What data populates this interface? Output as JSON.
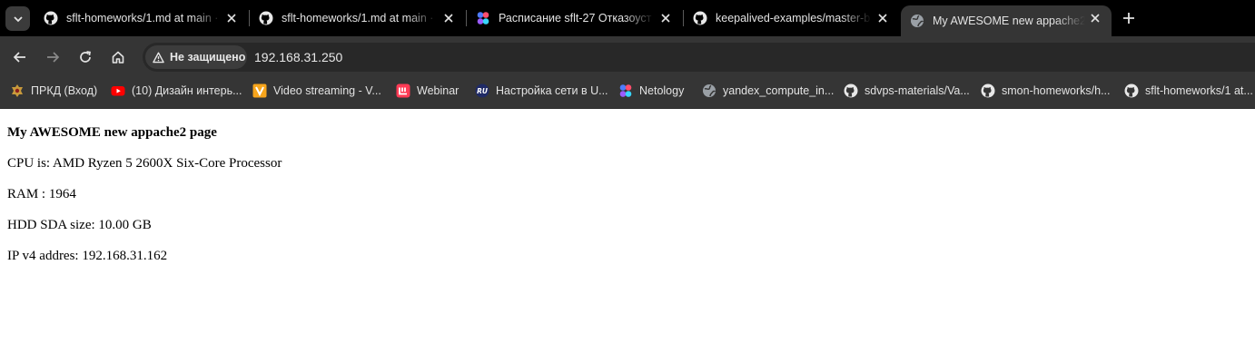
{
  "tabs": [
    {
      "title": "sflt-homeworks/1.md at main · ",
      "icon": "github-icon"
    },
    {
      "title": "sflt-homeworks/1.md at main · ",
      "icon": "github-icon"
    },
    {
      "title": "Расписание sflt-27 Отказоуст",
      "icon": "netology-icon"
    },
    {
      "title": "keepalived-examples/master-b",
      "icon": "github-icon"
    },
    {
      "title": "My AWESOME new appache2 p",
      "icon": "globe-icon"
    }
  ],
  "toolbar": {
    "security_label": "Не защищено",
    "url": "192.168.31.250"
  },
  "bookmarks": [
    {
      "label": "ПРКД (Вход)",
      "icon": "crest-icon"
    },
    {
      "label": "(10) Дизайн интерь...",
      "icon": "youtube-icon"
    },
    {
      "label": "Video streaming - V...",
      "icon": "vlc-icon"
    },
    {
      "label": "Webinar",
      "icon": "webinar-icon"
    },
    {
      "label": "Настройка сети в U...",
      "icon": "ru-icon"
    },
    {
      "label": "Netology",
      "icon": "netology-icon"
    },
    {
      "label": "yandex_compute_in...",
      "icon": "globe-icon"
    },
    {
      "label": "sdvps-materials/Va...",
      "icon": "github-icon"
    },
    {
      "label": "smon-homeworks/h...",
      "icon": "github-icon"
    },
    {
      "label": "sflt-homeworks/1 at...",
      "icon": "github-icon"
    }
  ],
  "page": {
    "heading": "My AWESOME new appache2 page",
    "cpu": "CPU is: AMD Ryzen 5 2600X Six-Core Processor",
    "ram": "RAM : 1964",
    "hdd": "HDD SDA size: 10.00 GB",
    "ip": "IP v4 addres: 192.168.31.162"
  },
  "colors": {
    "tabstrip": "#000000",
    "toolbar": "#353535",
    "omnibox": "#282828",
    "page_bg": "#ffffff"
  }
}
